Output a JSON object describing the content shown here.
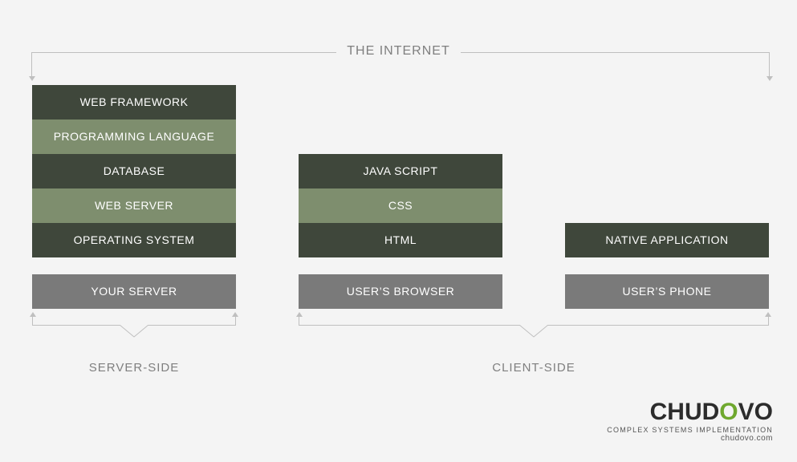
{
  "top_label": "THE INTERNET",
  "columns": {
    "server": {
      "stack": [
        {
          "label": "WEB FRAMEWORK",
          "style": "dark"
        },
        {
          "label": "PROGRAMMING LANGUAGE",
          "style": "olive"
        },
        {
          "label": "DATABASE",
          "style": "dark"
        },
        {
          "label": "WEB SERVER",
          "style": "olive"
        },
        {
          "label": "OPERATING SYSTEM",
          "style": "dark"
        }
      ],
      "base": "YOUR SERVER"
    },
    "browser": {
      "stack": [
        {
          "label": "JAVA SCRIPT",
          "style": "dark"
        },
        {
          "label": "CSS",
          "style": "olive"
        },
        {
          "label": "HTML",
          "style": "dark"
        }
      ],
      "base": "USER’S BROWSER"
    },
    "phone": {
      "stack": [
        {
          "label": "NATIVE APPLICATION",
          "style": "dark"
        }
      ],
      "base": "USER’S PHONE"
    }
  },
  "groups": {
    "server": "SERVER-SIDE",
    "client": "CLIENT-SIDE"
  },
  "branding": {
    "name_pre": "CHUD",
    "name_accent": "O",
    "name_post": "VO",
    "tagline": "COMPLEX SYSTEMS IMPLEMENTATION",
    "site": "chudovo.com"
  }
}
